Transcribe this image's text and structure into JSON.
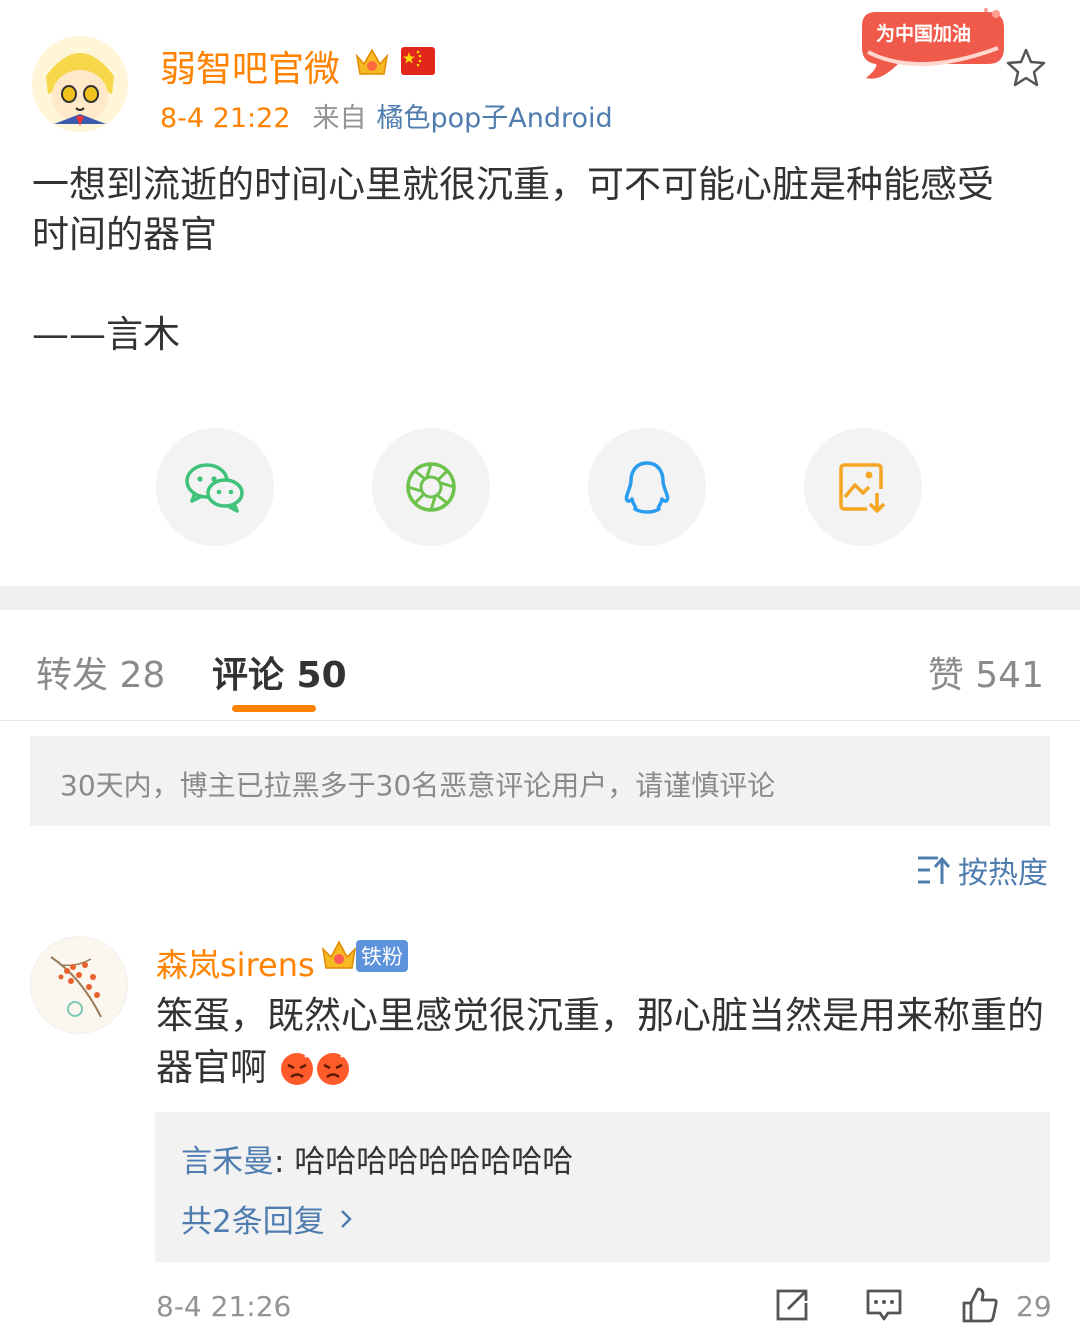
{
  "post": {
    "author": "弱智吧官微",
    "time": "8-4 21:22",
    "from_label": "来自",
    "source": "橘色pop子Android",
    "promo_badge": "为中国加油",
    "text_lines": [
      "一想到流逝的时间心里就很沉重，可不可能心脏是种能感受",
      "时间的器官"
    ],
    "signature": "——言木"
  },
  "share_icons": [
    "wechat-icon",
    "moments-icon",
    "qq-icon",
    "save-image-icon"
  ],
  "tabs": {
    "repost": "转发 28",
    "comments": "评论 50",
    "likes": "赞 541"
  },
  "notice": "30天内，博主已拉黑多于30名恶意评论用户，请谨慎评论",
  "sort_label": "按热度",
  "comment": {
    "user": "森岚sirens",
    "fan_badge": "铁粉",
    "text": "笨蛋，既然心里感觉很沉重，那心脏当然是用来称重的器官啊",
    "reply_user": "言禾曼",
    "reply_text": "哈哈哈哈哈哈哈哈哈",
    "reply_more": "共2条回复",
    "time": "8-4 21:26",
    "like_count": "29"
  },
  "colors": {
    "accent": "#ff8200",
    "link": "#507daf",
    "muted": "#939393"
  }
}
